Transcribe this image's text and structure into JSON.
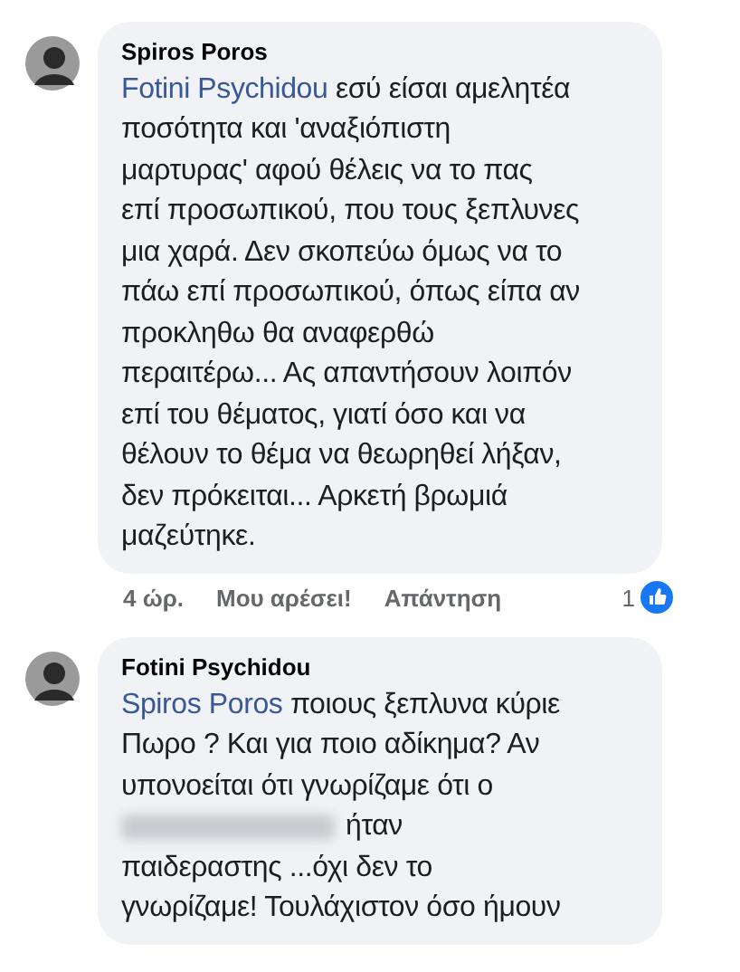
{
  "comments": [
    {
      "author": "Spiros Poros",
      "mention": "Fotini Psychidou",
      "lines": [
        {
          "text": " εσύ είσαι αμελητέα"
        },
        {
          "text": "ποσότητα και 'αναξιόπιστη"
        },
        {
          "text": "μαρτυρας' αφού θέλεις να το πας"
        },
        {
          "text": "επί προσωπικού, που τους ξεπλυνες"
        },
        {
          "text": "μια χαρά. Δεν σκοπεύω όμως να το"
        },
        {
          "text": "πάω επί προσωπικού, όπως είπα αν"
        },
        {
          "text": "προκληθω θα αναφερθώ"
        },
        {
          "text": "περαιτέρω... Ας απαντήσουν λοιπόν"
        },
        {
          "text": "επί του θέματος, γιατί όσο και να"
        },
        {
          "text": "θέλουν το θέμα να θεωρηθεί λήξαν,"
        },
        {
          "text": "δεν πρόκειται... Αρκετή βρωμιά"
        },
        {
          "text": "μαζεύτηκε."
        }
      ],
      "time": "4 ώρ.",
      "like": "Μου αρέσει!",
      "reply": "Απάντηση",
      "reactions": "1"
    },
    {
      "author": "Fotini Psychidou",
      "mention": "Spiros Poros",
      "lines": [
        {
          "text": " ποιους ξεπλυνα κύριε"
        },
        {
          "text": "Πωρο ? Και για ποιο αδίκημα? Αν"
        },
        {
          "text": "υπονοείται ότι γνωρίζαμε ότι ο"
        },
        {
          "text": "ήταν",
          "redacted": true
        },
        {
          "text": "παιδεραστης ...όχι δεν το"
        },
        {
          "text": "γνωρίζαμε! Τουλάχιστον όσο ήμουν"
        }
      ]
    }
  ]
}
